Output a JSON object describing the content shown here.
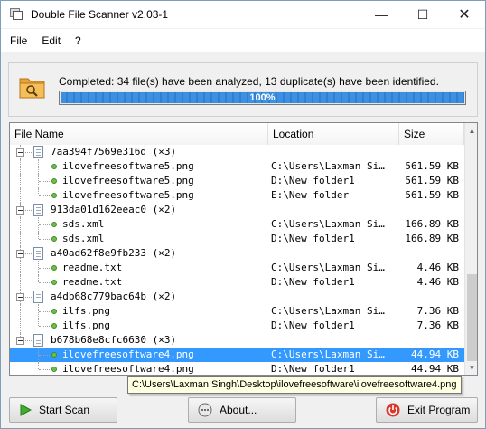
{
  "window": {
    "title": "Double File Scanner v2.03-1",
    "minimize_glyph": "—",
    "maximize_glyph": "☐",
    "close_glyph": "✕"
  },
  "menu": [
    "File",
    "Edit",
    "?"
  ],
  "status": {
    "message": "Completed: 34 file(s) have been analyzed, 13 duplicate(s) have been identified.",
    "progress_label": "100%",
    "progress_fraction": 1.0,
    "icon": "folder-search-icon"
  },
  "table": {
    "columns": [
      "File Name",
      "Location",
      "Size"
    ],
    "rows": [
      {
        "type": "group",
        "name": "7aa394f7569e316d (×3)"
      },
      {
        "type": "file",
        "name": "ilovefreesoftware5.png",
        "location": "C:\\Users\\Laxman Si…",
        "size": "561.59 KB"
      },
      {
        "type": "file",
        "name": "ilovefreesoftware5.png",
        "location": "D:\\New folder1",
        "size": "561.59 KB"
      },
      {
        "type": "file",
        "name": "ilovefreesoftware5.png",
        "location": "E:\\New folder",
        "size": "561.59 KB"
      },
      {
        "type": "group",
        "name": "913da01d162eeac0 (×2)"
      },
      {
        "type": "file",
        "name": "sds.xml",
        "location": "C:\\Users\\Laxman Si…",
        "size": "166.89 KB"
      },
      {
        "type": "file",
        "name": "sds.xml",
        "location": "D:\\New folder1",
        "size": "166.89 KB"
      },
      {
        "type": "group",
        "name": "a40ad62f8e9fb233 (×2)"
      },
      {
        "type": "file",
        "name": "readme.txt",
        "location": "C:\\Users\\Laxman Si…",
        "size": "4.46 KB"
      },
      {
        "type": "file",
        "name": "readme.txt",
        "location": "D:\\New folder1",
        "size": "4.46 KB"
      },
      {
        "type": "group",
        "name": "a4db68c779bac64b (×2)"
      },
      {
        "type": "file",
        "name": "ilfs.png",
        "location": "C:\\Users\\Laxman Si…",
        "size": "7.36 KB"
      },
      {
        "type": "file",
        "name": "ilfs.png",
        "location": "D:\\New folder1",
        "size": "7.36 KB"
      },
      {
        "type": "group",
        "name": "b678b68e8cfc6630 (×3)"
      },
      {
        "type": "file",
        "name": "ilovefreesoftware4.png",
        "location": "C:\\Users\\Laxman Si…",
        "size": "44.94 KB",
        "selected": true
      },
      {
        "type": "file",
        "name": "ilovefreesoftware4.png",
        "location": "D:\\New folder1",
        "size": "44.94 KB"
      }
    ]
  },
  "tooltip": "C:\\Users\\Laxman Singh\\Desktop\\ilovefreesoftware\\ilovefreesoftware4.png",
  "buttons": {
    "start_scan": "Start Scan",
    "about": "About...",
    "exit": "Exit Program"
  }
}
